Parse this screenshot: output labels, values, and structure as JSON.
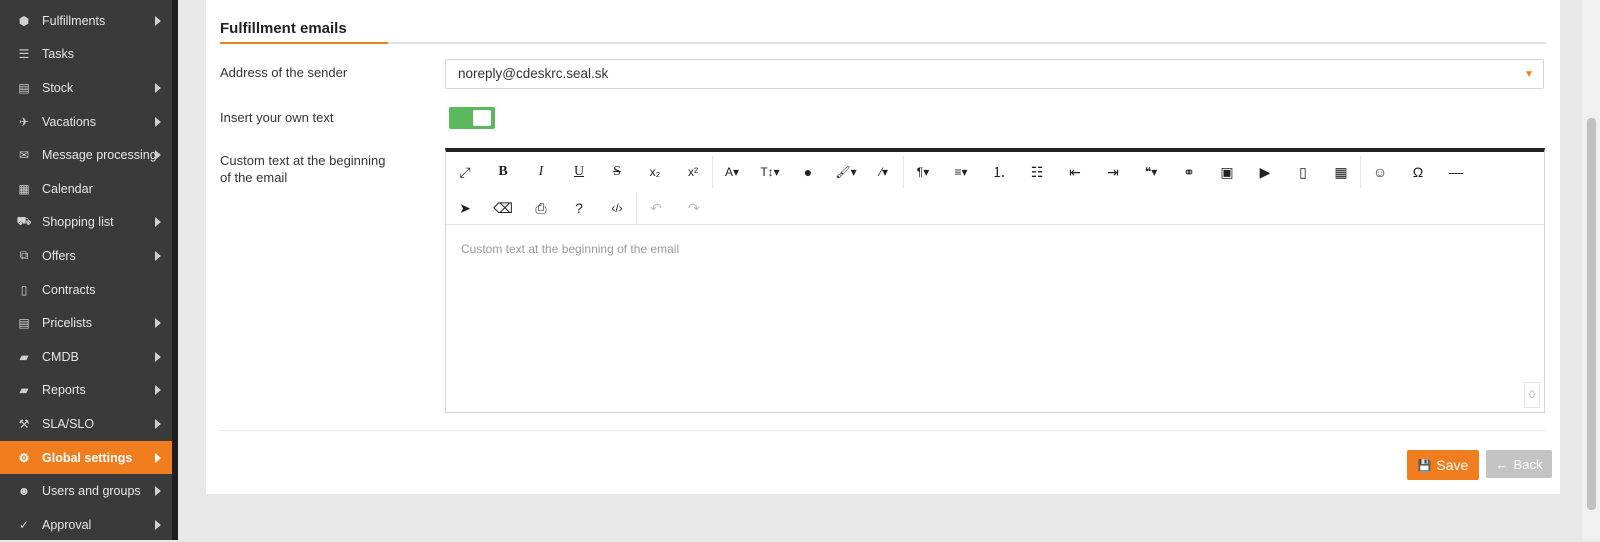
{
  "sidebar": {
    "items": [
      {
        "label": "Fulfillments",
        "icon": "cube-icon",
        "glyph": "⬢",
        "arrow": true,
        "active": false
      },
      {
        "label": "Tasks",
        "icon": "tasks-icon",
        "glyph": "☰",
        "arrow": false,
        "active": false
      },
      {
        "label": "Stock",
        "icon": "archive-icon",
        "glyph": "▤",
        "arrow": true,
        "active": false
      },
      {
        "label": "Vacations",
        "icon": "plane-icon",
        "glyph": "✈",
        "arrow": true,
        "active": false
      },
      {
        "label": "Message processing",
        "icon": "envelope-icon",
        "glyph": "✉",
        "arrow": true,
        "active": false
      },
      {
        "label": "Calendar",
        "icon": "calendar-icon",
        "glyph": "▦",
        "arrow": false,
        "active": false
      },
      {
        "label": "Shopping list",
        "icon": "cart-icon",
        "glyph": "⛟",
        "arrow": true,
        "active": false
      },
      {
        "label": "Offers",
        "icon": "gift-icon",
        "glyph": "⧉",
        "arrow": true,
        "active": false
      },
      {
        "label": "Contracts",
        "icon": "file-text-icon",
        "glyph": "▯",
        "arrow": false,
        "active": false
      },
      {
        "label": "Pricelists",
        "icon": "file-list-icon",
        "glyph": "▤",
        "arrow": true,
        "active": false
      },
      {
        "label": "CMDB",
        "icon": "folder-open-icon",
        "glyph": "▰",
        "arrow": true,
        "active": false
      },
      {
        "label": "Reports",
        "icon": "folder-open-icon",
        "glyph": "▰",
        "arrow": true,
        "active": false
      },
      {
        "label": "SLA/SLO",
        "icon": "gavel-icon",
        "glyph": "⚒",
        "arrow": true,
        "active": false
      },
      {
        "label": "Global settings",
        "icon": "cogs-icon",
        "glyph": "⚙",
        "arrow": true,
        "active": true
      },
      {
        "label": "Users and groups",
        "icon": "users-icon",
        "glyph": "☻",
        "arrow": true,
        "active": false
      },
      {
        "label": "Approval",
        "icon": "approval-icon",
        "glyph": "✓",
        "arrow": true,
        "active": false
      }
    ]
  },
  "form": {
    "section_title": "Fulfillment emails",
    "sender_label": "Address of the sender",
    "sender_value": "noreply@cdeskrc.seal.sk",
    "own_text_label": "Insert your own text",
    "own_text_enabled": true,
    "custom_text_label_line1": "Custom text at the beginning",
    "custom_text_label_line2": "of the email",
    "editor_placeholder": "Custom text at the beginning of the email",
    "char_count": "0"
  },
  "toolbar": {
    "row1": [
      {
        "name": "fullscreen-icon",
        "glyph": "⤢"
      },
      {
        "name": "bold-icon",
        "glyph": "B"
      },
      {
        "name": "italic-icon",
        "glyph": "I"
      },
      {
        "name": "underline-icon",
        "glyph": "U"
      },
      {
        "name": "strikethrough-icon",
        "glyph": "S"
      },
      {
        "name": "subscript-icon",
        "glyph": "x₂"
      },
      {
        "name": "superscript-icon",
        "glyph": "x²"
      },
      {
        "sep": true
      },
      {
        "name": "font-family-icon",
        "glyph": "A▾"
      },
      {
        "name": "font-size-icon",
        "glyph": "T↕▾"
      },
      {
        "name": "text-color-icon",
        "glyph": "●"
      },
      {
        "name": "paint-brush-icon",
        "glyph": "🖌▾"
      },
      {
        "name": "magic-wand-icon",
        "glyph": "⁄▾"
      },
      {
        "sep": true
      },
      {
        "name": "paragraph-icon",
        "glyph": "¶▾"
      },
      {
        "name": "align-icon",
        "glyph": "≡▾"
      },
      {
        "name": "ordered-list-icon",
        "glyph": "⒈"
      },
      {
        "name": "unordered-list-icon",
        "glyph": "☷"
      },
      {
        "name": "outdent-icon",
        "glyph": "⇤"
      },
      {
        "name": "indent-icon",
        "glyph": "⇥"
      },
      {
        "name": "quote-icon",
        "glyph": "❝▾"
      },
      {
        "name": "link-icon",
        "glyph": "⚭"
      },
      {
        "name": "image-icon",
        "glyph": "▣"
      },
      {
        "name": "video-icon",
        "glyph": "▶"
      },
      {
        "name": "file-icon",
        "glyph": "▯"
      },
      {
        "name": "table-icon",
        "glyph": "▦"
      },
      {
        "sep": true
      },
      {
        "name": "emoticon-icon",
        "glyph": "☺"
      },
      {
        "name": "special-char-icon",
        "glyph": "Ω"
      },
      {
        "name": "horizontal-line-icon",
        "glyph": "—"
      }
    ],
    "row2": [
      {
        "name": "select-all-icon",
        "glyph": "➤"
      },
      {
        "name": "clear-format-icon",
        "glyph": "⌫"
      },
      {
        "name": "print-icon",
        "glyph": "⎙"
      },
      {
        "name": "help-icon",
        "glyph": "?"
      },
      {
        "name": "code-view-icon",
        "glyph": "‹/›"
      },
      {
        "sep": true
      },
      {
        "name": "undo-icon",
        "glyph": "↶",
        "disabled": true
      },
      {
        "name": "redo-icon",
        "glyph": "↷",
        "disabled": true
      }
    ]
  },
  "buttons": {
    "save_icon": "💾",
    "save_label": "Save",
    "back_icon": "←",
    "back_label": "Back"
  },
  "colors": {
    "accent": "#f07d1e",
    "toggle_on": "#5cb85c",
    "sidebar_bg": "#3a3a3a"
  }
}
